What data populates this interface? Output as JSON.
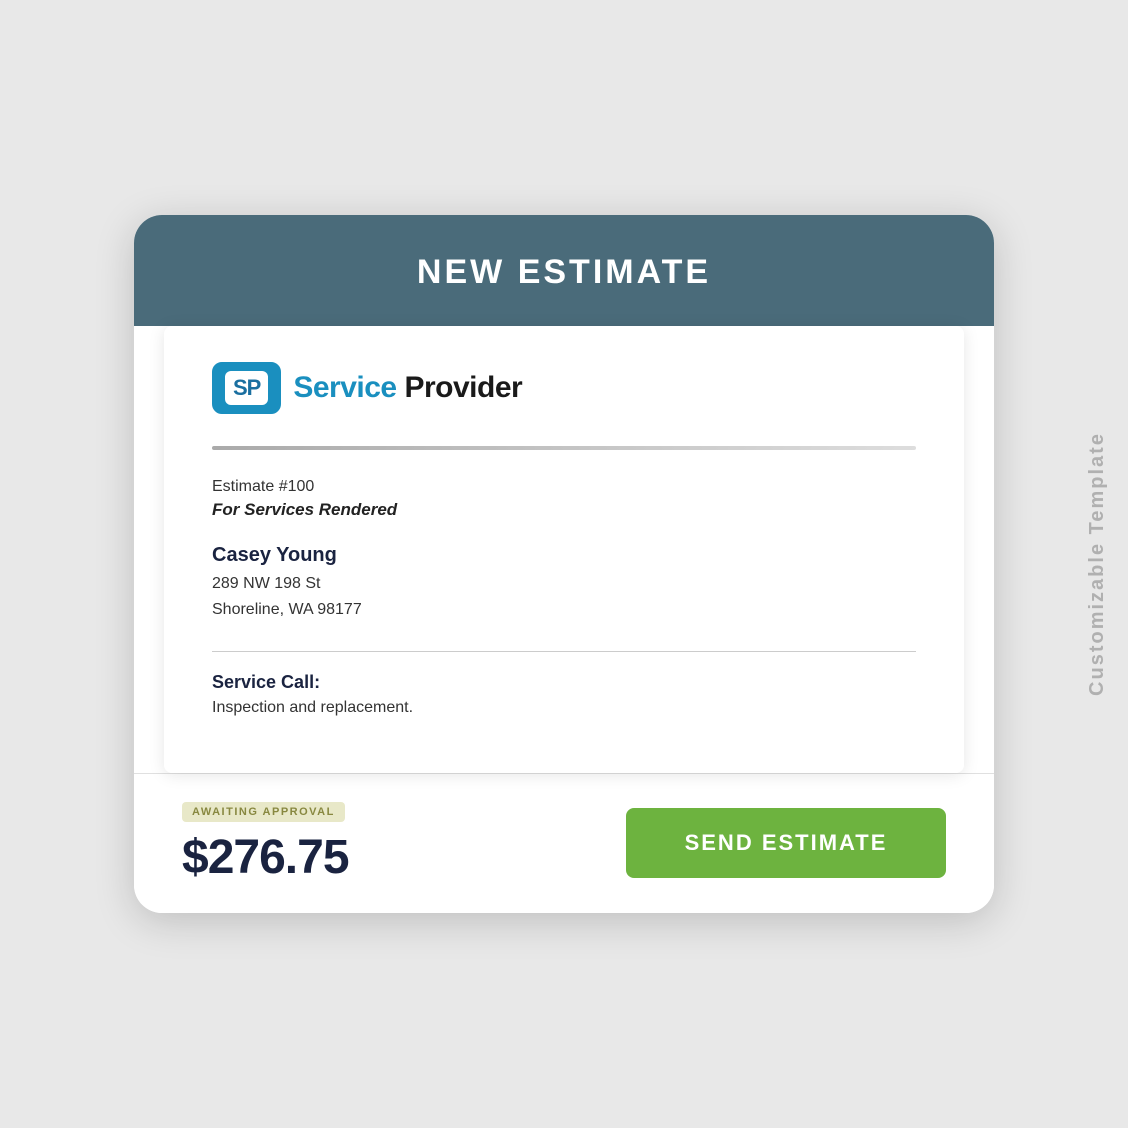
{
  "page": {
    "background_color": "#e8e8e8"
  },
  "side_label": "Customizable Template",
  "device": {
    "header": {
      "title": "NEW ESTIMATE",
      "background_color": "#4a6b7a"
    },
    "document": {
      "logo": {
        "badge_text": "SP",
        "company_name": "Service Provider"
      },
      "estimate": {
        "number": "Estimate #100",
        "subtitle": "For Services Rendered"
      },
      "customer": {
        "name": "Casey Young",
        "address_line1": "289 NW 198 St",
        "address_line2": "Shoreline, WA 98177"
      },
      "service": {
        "label": "Service Call:",
        "description": "Inspection and replacement."
      }
    },
    "bottom_bar": {
      "status_badge": "AWAITING APPROVAL",
      "amount": "$276.75",
      "send_button_label": "SEND ESTIMATE"
    }
  }
}
